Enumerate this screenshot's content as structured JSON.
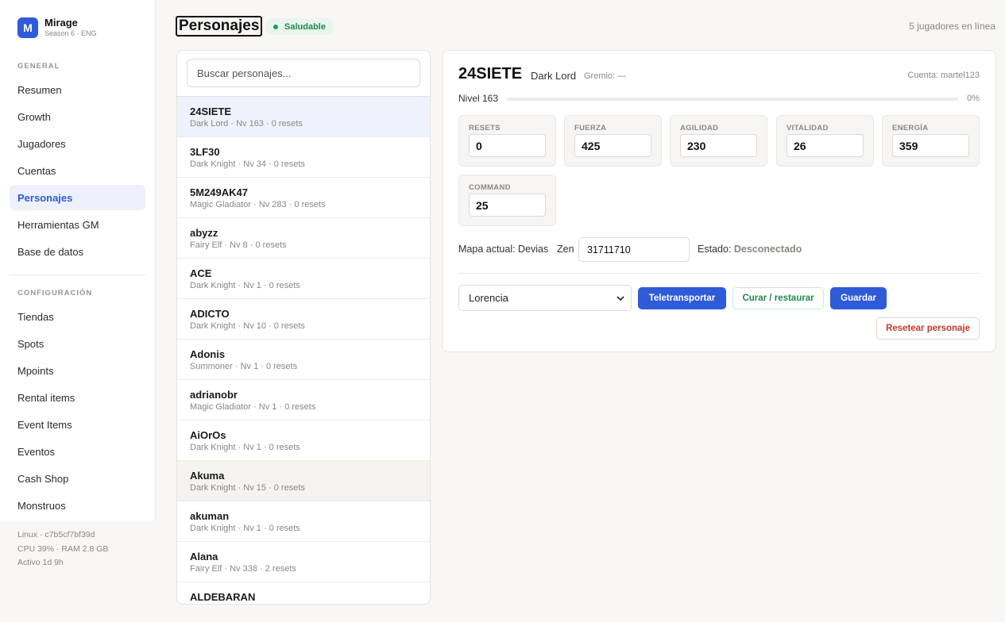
{
  "brand": {
    "logo_letter": "M",
    "name": "Mirage",
    "subtitle": "Season 6 · ENG"
  },
  "sidebar": {
    "general_label": "GENERAL",
    "general_items": [
      {
        "label": "Resumen",
        "active": false
      },
      {
        "label": "Growth",
        "active": false
      },
      {
        "label": "Jugadores",
        "active": false
      },
      {
        "label": "Cuentas",
        "active": false
      },
      {
        "label": "Personajes",
        "active": true
      },
      {
        "label": "Herramientas GM",
        "active": false
      },
      {
        "label": "Base de datos",
        "active": false
      }
    ],
    "config_label": "CONFIGURACIÓN",
    "config_items": [
      {
        "label": "Tiendas"
      },
      {
        "label": "Spots"
      },
      {
        "label": "Mpoints"
      },
      {
        "label": "Rental items"
      },
      {
        "label": "Event Items"
      },
      {
        "label": "Eventos"
      },
      {
        "label": "Cash Shop"
      },
      {
        "label": "Monstruos"
      }
    ],
    "system": {
      "host": "Linux · c7b5cf7bf39d",
      "resources": "CPU 39% · RAM 2.8 GB",
      "uptime": "Activo 1d 9h"
    }
  },
  "header": {
    "title": "Personajes",
    "status_badge": "Saludable",
    "online": "5 jugadores en línea"
  },
  "search": {
    "placeholder": "Buscar personajes..."
  },
  "characters": [
    {
      "name": "24SIETE",
      "meta": "Dark Lord · Nv 163 · 0 resets"
    },
    {
      "name": "3LF30",
      "meta": "Dark Knight · Nv 34 · 0 resets"
    },
    {
      "name": "5M249AK47",
      "meta": "Magic Gladiator · Nv 283 · 0 resets"
    },
    {
      "name": "abyzz",
      "meta": "Fairy Elf · Nv 8 · 0 resets"
    },
    {
      "name": "ACE",
      "meta": "Dark Knight · Nv 1 · 0 resets"
    },
    {
      "name": "ADICTO",
      "meta": "Dark Knight · Nv 10 · 0 resets"
    },
    {
      "name": "Adonis",
      "meta": "Summoner · Nv 1 · 0 resets"
    },
    {
      "name": "adrianobr",
      "meta": "Magic Gladiator · Nv 1 · 0 resets"
    },
    {
      "name": "AiOrOs",
      "meta": "Dark Knight · Nv 1 · 0 resets"
    },
    {
      "name": "Akuma",
      "meta": "Dark Knight · Nv 15 · 0 resets"
    },
    {
      "name": "akuman",
      "meta": "Dark Knight · Nv 1 · 0 resets"
    },
    {
      "name": "Alana",
      "meta": "Fairy Elf · Nv 338 · 2 resets"
    },
    {
      "name": "ALDEBARAN",
      "meta": ""
    }
  ],
  "detail": {
    "name": "24SIETE",
    "class": "Dark Lord",
    "guild": "Gremio: —",
    "account": "Cuenta: martel123",
    "level_label": "Nivel 163",
    "progress_fraction": 0,
    "progress_text": "0%",
    "stats": [
      {
        "label": "RESETS",
        "value": "0"
      },
      {
        "label": "FUERZA",
        "value": "425"
      },
      {
        "label": "AGILIDAD",
        "value": "230"
      },
      {
        "label": "VITALIDAD",
        "value": "26"
      },
      {
        "label": "ENERGÍA",
        "value": "359"
      },
      {
        "label": "COMMAND",
        "value": "25"
      }
    ],
    "map_label": "Mapa actual: Devias",
    "zen_label": "Zen",
    "zen_value": "31711710",
    "status_label": "Estado:",
    "status_value": "Desconectado",
    "map_select": "Lorencia",
    "btn_teleport": "Teletransportar",
    "btn_heal": "Curar / restaurar",
    "btn_save": "Guardar",
    "btn_reset": "Resetear personaje"
  }
}
